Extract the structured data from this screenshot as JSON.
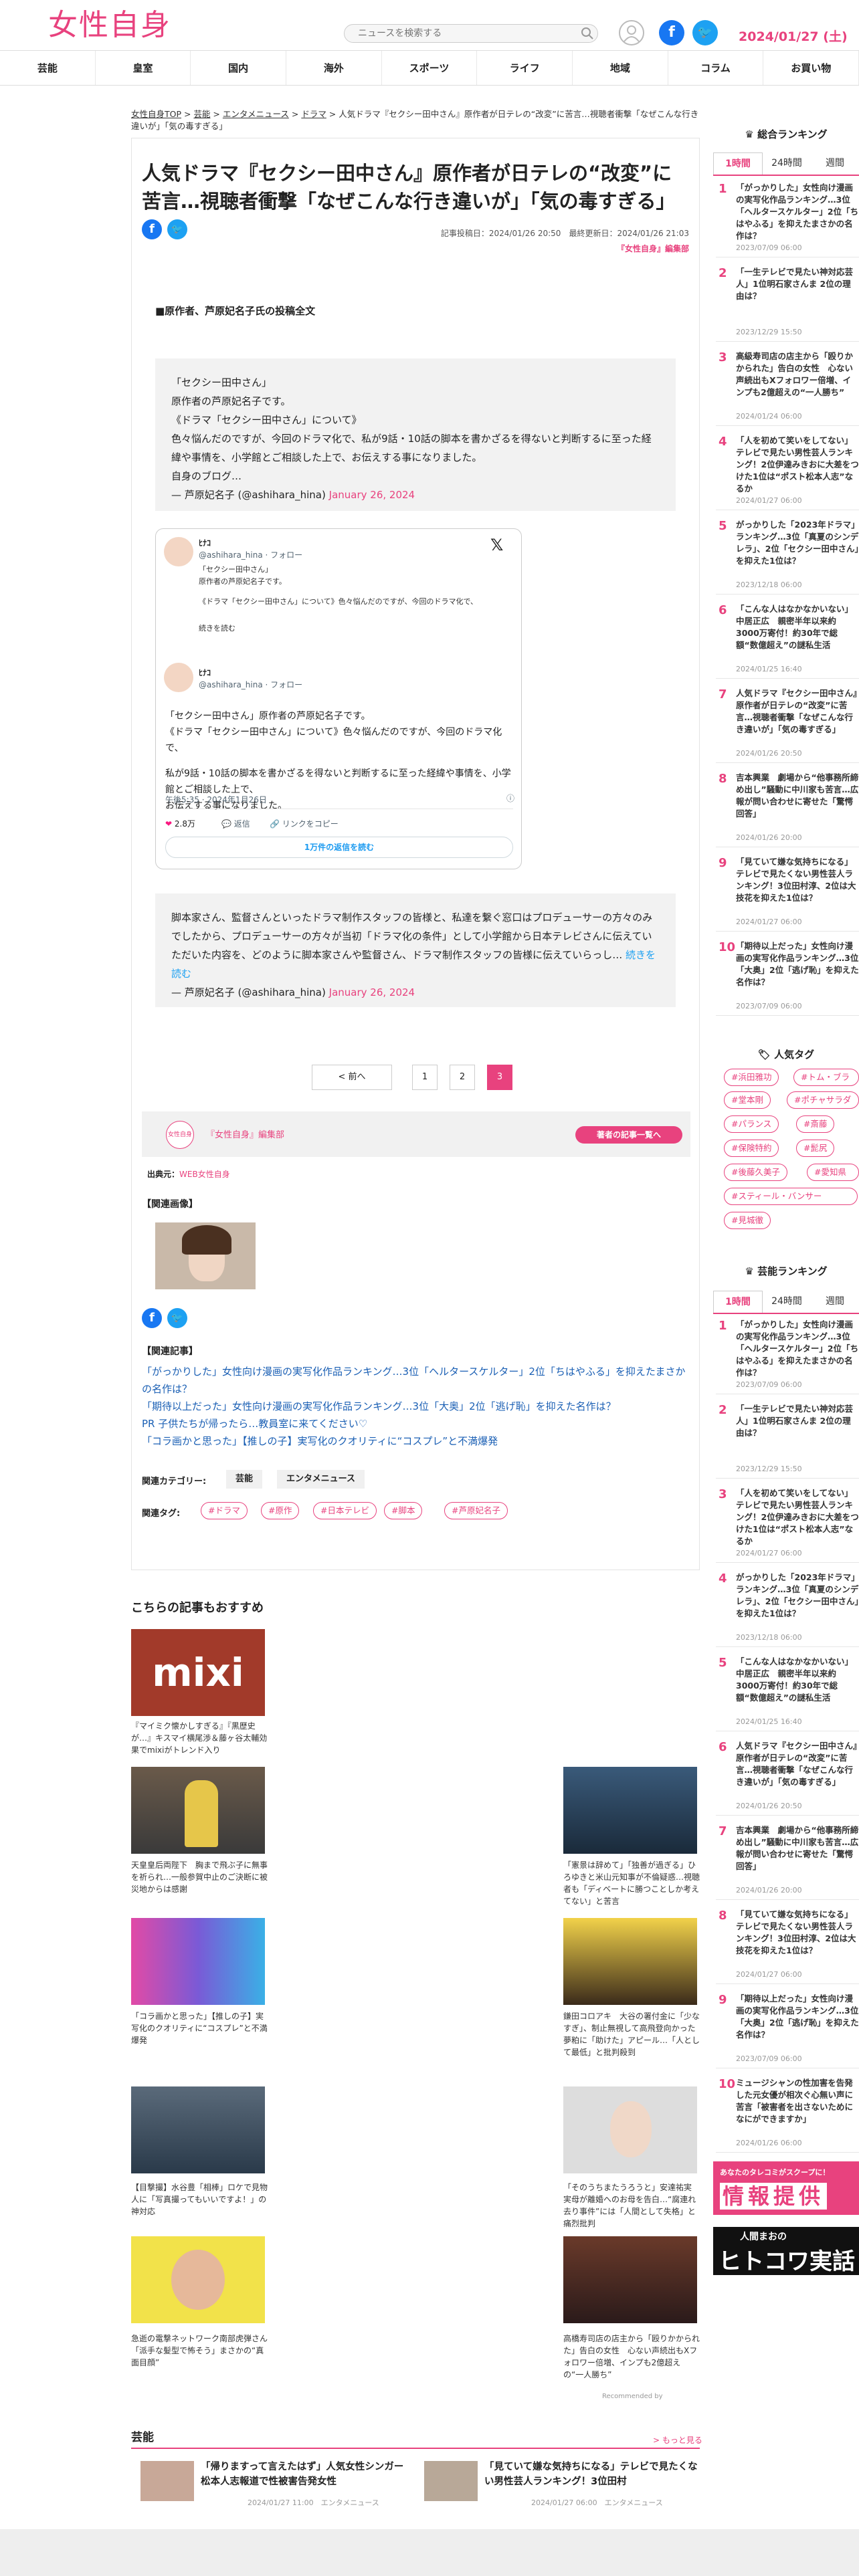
{
  "header": {
    "logo": "女性自身",
    "search_placeholder": "ニュースを検索する",
    "date": "2024/01/27 (土)"
  },
  "nav": [
    "芸能",
    "皇室",
    "国内",
    "海外",
    "スポーツ",
    "ライフ",
    "地域",
    "コラム",
    "お買い物"
  ],
  "breadcrumb": {
    "items": [
      "女性自身TOP",
      "芸能",
      "エンタメニュース",
      "ドラマ"
    ],
    "current": "人気ドラマ『セクシー田中さん』原作者が日テレの“改変”に苦言…視聴者衝撃「なぜこんな行き違いが」「気の毒すぎる」"
  },
  "article": {
    "title": "人気ドラマ『セクシー田中さん』原作者が日テレの“改変”に苦言…視聴者衝撃「なぜこんな行き違いが」「気の毒すぎる」",
    "posted": "記事投稿日：2024/01/26 20:50",
    "updated": "最終更新日：2024/01/26 21:03",
    "editor": "『女性自身』編集部",
    "subhead": "■原作者、芦原妃名子氏の投稿全文",
    "quote1": [
      "「セクシー田中さん」",
      "原作者の芦原妃名子です。",
      "《ドラマ「セクシー田中さん」について》",
      "色々悩んだのですが、今回のドラマ化で、私が9話・10話の脚本を書かざるを得ないと判断するに至った経緯や事情を、小学館とご相談した上で、お伝えする事になりました。",
      "自身のブログ…"
    ],
    "quote1_src": "— 芦原妃名子 (@ashihara_hina)",
    "quote1_date": "January 26, 2024",
    "tweet": {
      "name": "ﾋﾅｺ",
      "handle": "@ashihara_hina · フォロー",
      "line1": "「セクシー田中さん」",
      "line2": "原作者の芦原妃名子です。",
      "body1": "「セクシー田中さん」原作者の芦原妃名子です。",
      "body2": "《ドラマ「セクシー田中さん」について》色々悩んだのですが、今回のドラマ化で、",
      "body3": "私が9話・10話の脚本を書かざるを得ないと判断するに至った経緯や事情を、小学館とご相談した上で、",
      "body4": "お伝えする事になりました。",
      "more": "続きを読む",
      "time": "午後5:35 · 2024年1月26日",
      "likes": "2.8万",
      "reply": "返信",
      "copy": "リンクをコピー",
      "readall": "1万件の返信を読む"
    },
    "quote2": "脚本家さん、監督さんといったドラマ制作スタッフの皆様と、私達を繋ぐ窓口はプロデューサーの方々のみでしたから、プロデューサーの方々が当初「ドラマ化の条件」として小学館から日本テレビさんに伝えていただいた内容を、どのように脚本家さんや監督さん、ドラマ制作スタッフの皆様に伝えていらっし…",
    "quote2_link": "続きを読む",
    "quote2_src": "— 芦原妃名子 (@ashihara_hina)",
    "quote2_date": "January 26, 2024",
    "pager": {
      "prev": "< 前へ",
      "p1": "1",
      "p2": "2",
      "p3": "3"
    },
    "author": {
      "badge": "女性自身",
      "name": "『女性自身』編集部",
      "button": "著者の記事一覧へ"
    },
    "source_label": "出典元：",
    "source": "WEB女性自身",
    "related_images_label": "【関連画像】",
    "related_articles_label": "【関連記事】",
    "related": [
      "「がっかりした」女性向け漫画の実写化作品ランキング…3位「ヘルタースケルター」2位「ちはやふる」を抑えたまさかの名作は？",
      "「期待以上だった」女性向け漫画の実写化作品ランキング…3位「大奥」2位「逃げ恥」を抑えた名作は？",
      "PR 子供たちが帰ったら…教員室に来てください♡",
      "「コラ画かと思った」【推しの子】実写化のクオリティに“コスプレ”と不満爆発"
    ],
    "categories_label": "関連カテゴリー:",
    "categories": [
      "芸能",
      "エンタメニュース"
    ],
    "tags_label": "関連タグ:",
    "tags": [
      "#ドラマ",
      "#原作",
      "#日本テレビ",
      "#脚本",
      "#芦原妃名子"
    ]
  },
  "recommend": {
    "title": "こちらの記事もおすすめ",
    "left": [
      {
        "img": "mixi",
        "text": "『マイミク懐かしすぎる』『黒歴史が…』キスマイ横尾渉＆藤ヶ谷太輔効果でmixiがトレンド入り"
      },
      {
        "img": "",
        "text": "天皇皇后両陛下　胸まで飛ぶ子に無事を祈られ…一般参賀中止のご決断に被災地からは感謝"
      },
      {
        "img": "",
        "text": "「コラ画かと思った」【推しの子】実写化のクオリティに“コスプレ”と不満爆発"
      },
      {
        "img": "",
        "text": "【目撃撮】水谷豊「相棒」ロケで見物人に「写真撮ってもいいですよ！」の神対応"
      },
      {
        "img": "",
        "text": "急逝の電撃ネットワーク南部虎弾さん「派手な髪型で怖そう」まさかの“真面目顔”"
      }
    ],
    "right": [
      {
        "text": "「憲景は辞めて」「独善が過ぎる」ひろゆきと米山元知事が不倫疑惑…視聴者も「ディベートに勝つことしか考えてない」と苦言"
      },
      {
        "text": "鎌田コロアキ　大谷の署付金に「少なすぎ」、制止無視して高飛登向かった夢粕に「助けた」アピール…「人として最低」と批判殺到"
      },
      {
        "text": "「そのうちまたうろうと」安達祐実　実母が離婚へのお母を告白…“腐連れ去り事件”には「人間として失格」と痛烈批判"
      },
      {
        "text": "高橋寿司店の店主から「殴りかかられた」告白の女性　心ない声続出もXフォロワー倍増、インプも2億超えの“一人勝ち”"
      }
    ],
    "recommended_by": "Recommended by"
  },
  "bottom": {
    "title": "芸能",
    "more": "> もっと見る",
    "items": [
      {
        "text": "「帰りますって言えたはず」人気女性シンガー　松本人志報道で性被害告発女性",
        "date": "2024/01/27 11:00",
        "cat": "エンタメニュース"
      },
      {
        "text": "「見ていて嫌な気持ちになる」テレビで見たくない男性芸人ランキング！3位田村",
        "date": "2024/01/27 06:00",
        "cat": "エンタメニュース"
      }
    ]
  },
  "sidebar": {
    "ranking_title": "総合ランキング",
    "tabs": [
      "1時間",
      "24時間",
      "週間"
    ],
    "ranking": [
      {
        "text": "「がっかりした」女性向け漫画の実写化作品ランキング…3位「ヘルタースケルター」2位「ちはやふる」を抑えたまさかの名作は？",
        "date": "2023/07/09 06:00"
      },
      {
        "text": "「一生テレビで見たい神対応芸人」1位明石家さんま 2位の理由は？",
        "date": "2023/12/29 15:50"
      },
      {
        "text": "高級寿司店の店主から「殴りかかられた」告白の女性　心ない声続出もXフォロワー倍増、インプも2億超えの“一人勝ち”",
        "date": "2024/01/24 06:00"
      },
      {
        "text": "「人を初めて笑いをしてない」テレビで見たい男性芸人ランキング！2位伊達みきおに大差をつけた1位は“ポスト松本人志”なるか",
        "date": "2024/01/27 06:00"
      },
      {
        "text": "がっかりした「2023年ドラマ」ランキング…3位「真夏のシンデレラ」、2位「セクシー田中さん」を抑えた1位は？",
        "date": "2023/12/18 06:00"
      },
      {
        "text": "「こんな人はなかなかいない」中居正広　親密半年以来約3000万寄付！約30年で総額“数億超え”の謎私生活",
        "date": "2024/01/25 16:40"
      },
      {
        "text": "人気ドラマ『セクシー田中さん』原作者が日テレの“改変”に苦言…視聴者衝撃「なぜこんな行き違いが」「気の毒すぎる」",
        "date": "2024/01/26 20:50"
      },
      {
        "text": "吉本興業　劇場から“他事務所締め出し”騒動に中川家も苦言…広報が問い合わせに寄せた「驚愕回答」",
        "date": "2024/01/26 20:00"
      },
      {
        "text": "「見ていて嫌な気持ちになる」テレビで見たくない男性芸人ランキング！3位田村淳、2位は大技花を抑えた1位は？",
        "date": "2024/01/27 06:00"
      },
      {
        "text": "「期待以上だった」女性向け漫画の実写化作品ランキング…3位「大奥」2位「逃げ恥」を抑えた名作は？",
        "date": "2023/07/09 06:00"
      }
    ],
    "tags_title": "人気タグ",
    "tags": [
      "#浜田雅功",
      "#トム・ブラ",
      "#堂本剛",
      "#ポチャサラダ",
      "#パランス",
      "#斎藤",
      "#保険特約",
      "#髭尻",
      "#後藤久美子",
      "#愛知県",
      "#スティール・バンサー",
      "#見城徹"
    ],
    "geino_title": "芸能ランキング",
    "geino": [
      {
        "text": "「がっかりした」女性向け漫画の実写化作品ランキング…3位「ヘルタースケルター」2位「ちはやふる」を抑えたまさかの名作は？",
        "date": "2023/07/09 06:00"
      },
      {
        "text": "「一生テレビで見たい神対応芸人」1位明石家さんま 2位の理由は？",
        "date": "2023/12/29 15:50"
      },
      {
        "text": "「人を初めて笑いをしてない」テレビで見たい男性芸人ランキング！2位伊達みきおに大差をつけた1位は“ポスト松本人志”なるか",
        "date": "2024/01/27 06:00"
      },
      {
        "text": "がっかりした「2023年ドラマ」ランキング…3位「真夏のシンデレラ」、2位「セクシー田中さん」を抑えた1位は？",
        "date": "2023/12/18 06:00"
      },
      {
        "text": "「こんな人はなかなかいない」中居正広　親密半年以来約3000万寄付！約30年で総額“数億超え”の謎私生活",
        "date": "2024/01/25 16:40"
      },
      {
        "text": "人気ドラマ『セクシー田中さん』原作者が日テレの“改変”に苦言…視聴者衝撃「なぜこんな行き違いが」「気の毒すぎる」",
        "date": "2024/01/26 20:50"
      },
      {
        "text": "吉本興業　劇場から“他事務所締め出し”騒動に中川家も苦言…広報が問い合わせに寄せた「驚愕回答」",
        "date": "2024/01/26 20:00"
      },
      {
        "text": "「見ていて嫌な気持ちになる」テレビで見たくない男性芸人ランキング！3位田村淳、2位は大技花を抑えた1位は？",
        "date": "2024/01/27 06:00"
      },
      {
        "text": "「期待以上だった」女性向け漫画の実写化作品ランキング…3位「大奥」2位「逃げ恥」を抑えた名作は？",
        "date": "2023/07/09 06:00"
      },
      {
        "text": "ミュージシャンの性加害を告発した元女優が相次ぐ心無い声に苦言「被害者を出さないためになにができますか」",
        "date": "2024/01/26 06:00"
      }
    ],
    "banner1": "あなたのタレコミがスクープに！",
    "banner1_big": "情報提供",
    "banner2_small": "人間まおの",
    "banner2_big": "ヒトコワ実話"
  },
  "colors": {
    "accent": "#e8427e",
    "facebook": "#1877f2",
    "twitter": "#1da1f2"
  }
}
